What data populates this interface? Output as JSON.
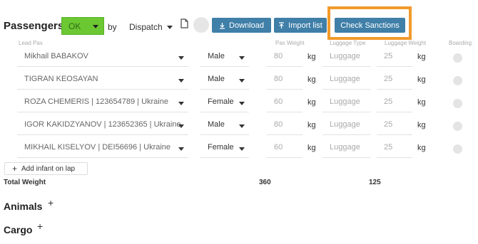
{
  "header": {
    "title": "Passengers",
    "status_value": "OK",
    "by_label": "by",
    "dispatch_value": "Dispatch",
    "download_label": "Download",
    "import_label": "Import list",
    "sanctions_label": "Check Sanctions"
  },
  "columns": {
    "lead_pax": "Lead Pax",
    "pax_weight": "Pax Weight",
    "luggage_type": "Luggage Type",
    "luggage_weight": "Luggage Weight",
    "boarding": "Boarding"
  },
  "rows": [
    {
      "name": "Mikhail BABAKOV",
      "gender": "Male",
      "weight": "80",
      "unit": "kg",
      "luggage_type": "Luggage",
      "luggage_weight": "25",
      "luggage_unit": "kg"
    },
    {
      "name": "TIGRAN KEOSAYAN",
      "gender": "Male",
      "weight": "80",
      "unit": "kg",
      "luggage_type": "Luggage",
      "luggage_weight": "25",
      "luggage_unit": "kg"
    },
    {
      "name": "ROZA CHEMERIS | 123654789 | Ukraine",
      "gender": "Female",
      "weight": "60",
      "unit": "kg",
      "luggage_type": "Luggage",
      "luggage_weight": "25",
      "luggage_unit": "kg"
    },
    {
      "name": "IGOR KAKIDZYANOV | 123652365 | Ukraine",
      "gender": "Male",
      "weight": "80",
      "unit": "kg",
      "luggage_type": "Luggage",
      "luggage_weight": "25",
      "luggage_unit": "kg"
    },
    {
      "name": "MIKHAIL KISELYOV | DEI56696 | Ukraine",
      "gender": "Female",
      "weight": "60",
      "unit": "kg",
      "luggage_type": "Luggage",
      "luggage_weight": "25",
      "luggage_unit": "kg"
    }
  ],
  "add_infant_label": "Add infant on lap",
  "totals": {
    "label": "Total Weight",
    "pax_weight": "360",
    "luggage_weight": "125"
  },
  "sections": {
    "animals": "Animals",
    "cargo": "Cargo"
  },
  "colors": {
    "status_green": "#6cc832",
    "button_blue": "#3f7fa8",
    "highlight_orange": "#f29a2b"
  },
  "icons": [
    "chevron-down-icon",
    "document-icon",
    "download-icon",
    "upload-icon",
    "plus-icon"
  ]
}
